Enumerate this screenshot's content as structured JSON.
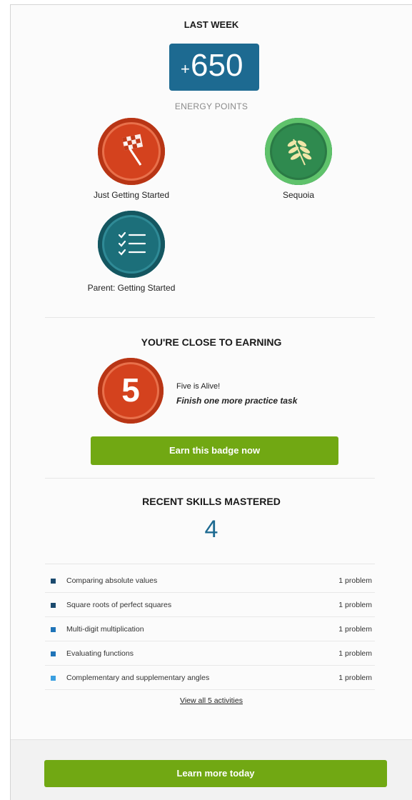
{
  "last_week": {
    "title": "LAST WEEK",
    "points_sign": "+",
    "points_value": "650",
    "points_label": "ENERGY POINTS"
  },
  "badges": [
    {
      "label": "Just Getting Started",
      "icon": "checkered-flag-icon",
      "color": "#d4421e"
    },
    {
      "label": "Sequoia",
      "icon": "leaf-icon",
      "color": "#3aa05a"
    },
    {
      "label": "Parent: Getting Started",
      "icon": "checklist-icon",
      "color": "#1c7480"
    }
  ],
  "close_to_earning": {
    "title": "YOU'RE CLOSE TO EARNING",
    "badge_number": "5",
    "badge_name": "Five is Alive!",
    "task": "Finish one more practice task",
    "button_label": "Earn this badge now"
  },
  "skills": {
    "title": "RECENT SKILLS MASTERED",
    "count": "4",
    "items": [
      {
        "name": "Comparing absolute values",
        "count": "1 problem",
        "color": "#1b4a6e"
      },
      {
        "name": "Square roots of perfect squares",
        "count": "1 problem",
        "color": "#1b4a6e"
      },
      {
        "name": "Multi-digit multiplication",
        "count": "1 problem",
        "color": "#1f74b8"
      },
      {
        "name": "Evaluating functions",
        "count": "1 problem",
        "color": "#1f74b8"
      },
      {
        "name": "Complementary and supplementary angles",
        "count": "1 problem",
        "color": "#3b9fe0"
      }
    ],
    "view_all": "View all 5 activities"
  },
  "footer": {
    "button_label": "Learn more today"
  },
  "colors": {
    "accent_blue": "#1d6a91",
    "button_green": "#71a813"
  }
}
